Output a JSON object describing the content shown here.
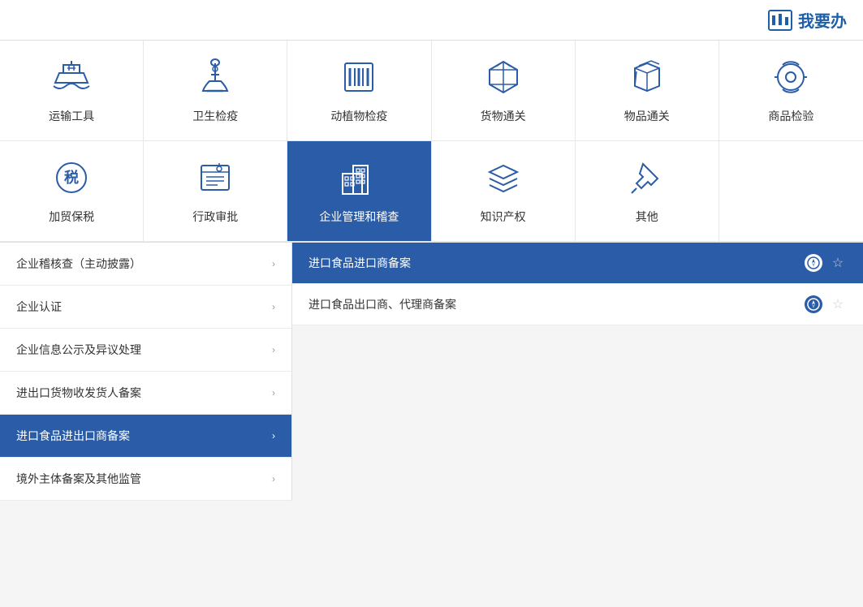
{
  "header": {
    "logo_text": "我要办",
    "logo_icon": "checklist"
  },
  "top_grid_row1": [
    {
      "id": "transport",
      "label": "运输工具",
      "icon": "ship"
    },
    {
      "id": "health",
      "label": "卫生检疫",
      "icon": "microscope"
    },
    {
      "id": "animal_plant",
      "label": "动植物检疫",
      "icon": "barcode"
    },
    {
      "id": "cargo_customs",
      "label": "货物通关",
      "icon": "box"
    },
    {
      "id": "goods_customs",
      "label": "物品通关",
      "icon": "cube"
    },
    {
      "id": "inspection",
      "label": "商品检验",
      "icon": "eye_scan"
    }
  ],
  "top_grid_row2": [
    {
      "id": "tax",
      "label": "加贸保税",
      "icon": "tax"
    },
    {
      "id": "admin",
      "label": "行政审批",
      "icon": "admin"
    },
    {
      "id": "enterprise",
      "label": "企业管理和稽查",
      "icon": "building",
      "active": true
    },
    {
      "id": "ip",
      "label": "知识产权",
      "icon": "layers"
    },
    {
      "id": "other",
      "label": "其他",
      "icon": "pin"
    }
  ],
  "left_menu": [
    {
      "id": "audit",
      "label": "企业稽核查（主动披露）",
      "active": false
    },
    {
      "id": "cert",
      "label": "企业认证",
      "active": false
    },
    {
      "id": "info",
      "label": "企业信息公示及异议处理",
      "active": false
    },
    {
      "id": "filing",
      "label": "进出口货物收发货人备案",
      "active": false
    },
    {
      "id": "food_import",
      "label": "进口食品进出口商备案",
      "active": true
    },
    {
      "id": "overseas",
      "label": "境外主体备案及其他监管",
      "active": false
    }
  ],
  "right_items": [
    {
      "id": "food_import_reg",
      "label": "进口食品进口商备案",
      "active": true
    },
    {
      "id": "food_export_reg",
      "label": "进口食品出口商、代理商备案",
      "active": false
    }
  ],
  "icons": {
    "chevron_right": "›",
    "compass": "⊙",
    "star": "☆"
  }
}
